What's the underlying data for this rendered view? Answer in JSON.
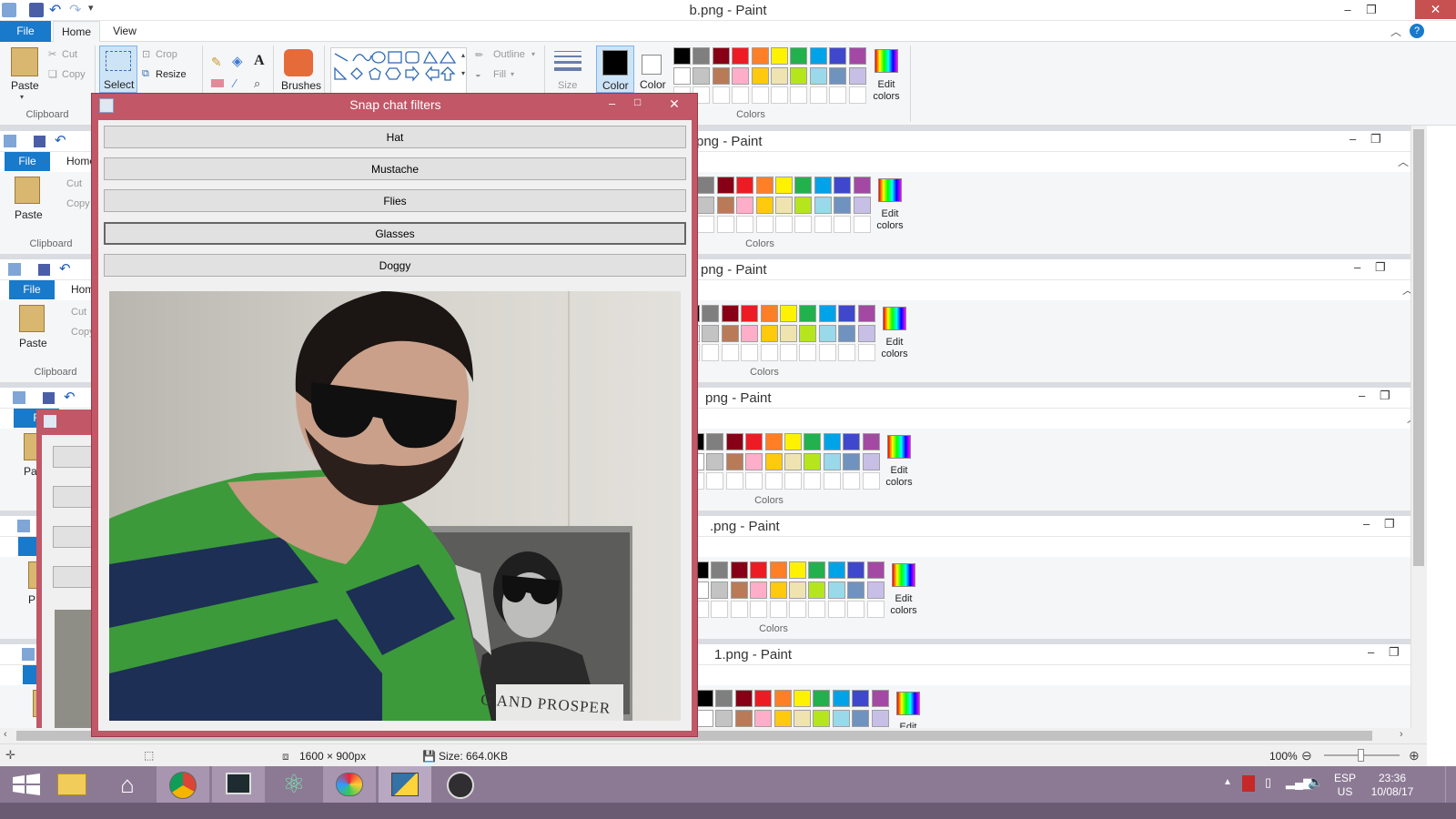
{
  "paint": {
    "title": "b.png - Paint",
    "menu": {
      "file": "File",
      "home": "Home",
      "view": "View"
    },
    "clipboard": {
      "paste": "Paste",
      "cut": "Cut",
      "copy": "Copy",
      "group": "Clipboard"
    },
    "image": {
      "select": "Select",
      "crop": "Crop",
      "resize": "Resize"
    },
    "tools_group": {
      "brushes": "Brushes"
    },
    "shapes": {
      "outline": "Outline",
      "fill": "Fill"
    },
    "size_label": "Size",
    "color1": "Color",
    "color2": "Color",
    "edit_colors": [
      "Edit",
      "colors"
    ],
    "colors_group": "Colors",
    "palette_row1": [
      "#000000",
      "#7f7f7f",
      "#880015",
      "#ed1c24",
      "#ff7f27",
      "#fff200",
      "#22b14c",
      "#00a2e8",
      "#3f48cc",
      "#a349a4"
    ],
    "palette_row2": [
      "#ffffff",
      "#c3c3c3",
      "#b97a57",
      "#ffaec9",
      "#ffc90e",
      "#efe4b0",
      "#b5e61d",
      "#99d9ea",
      "#7092be",
      "#c8bfe7"
    ]
  },
  "cascade_windows": [
    {
      "title": "png - Paint",
      "file": "File",
      "home": "Home",
      "paste": "Paste",
      "cut": "Cut",
      "copy": "Copy",
      "clipboard": "Clipboard",
      "colors": "Colors"
    },
    {
      "title": "png - Paint",
      "file": "File",
      "home": "Hom",
      "paste": "Paste",
      "cut": "Cut",
      "copy": "Copy",
      "clipboard": "Clipboard",
      "colors": "Colors"
    },
    {
      "title": "png - Paint",
      "file": "F",
      "home": "",
      "paste": "Pa",
      "cut": "",
      "copy": "",
      "clipboard": "",
      "colors": "Colors"
    },
    {
      "title": ".png - Paint",
      "file": "",
      "home": "",
      "paste": "P",
      "cut": "",
      "copy": "",
      "clipboard": "",
      "colors": "Colors"
    },
    {
      "title": "1.png - Paint",
      "file": "",
      "home": "",
      "paste": "",
      "cut": "",
      "copy": "",
      "clipboard": "",
      "colors": ""
    }
  ],
  "snap": {
    "title": "Snap chat filters",
    "buttons": [
      "Hat",
      "Mustache",
      "Flies",
      "Glasses",
      "Doggy"
    ],
    "poster_text": "G AND PROSPER"
  },
  "status": {
    "dimensions": "1600 × 900px",
    "size": "Size: 664.0KB",
    "zoom": "100%"
  },
  "taskbar": {
    "icons": [
      "windows-start-icon",
      "file-explorer-icon",
      "home-icon",
      "chrome-icon",
      "terminal-icon",
      "atom-icon",
      "paint-icon",
      "python-icon",
      "obs-icon"
    ],
    "lang": "ESP",
    "region": "US",
    "time": "23:36",
    "date": "10/08/17"
  }
}
